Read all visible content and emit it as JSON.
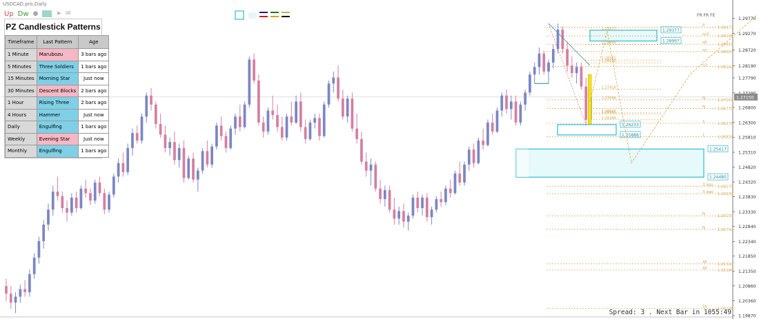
{
  "window_title": "USDCAD.pro,Daily",
  "toolbar": {
    "up": "Up",
    "dw": "Dw",
    "icons": [
      "drop-icon",
      "hand-icon",
      "plane-icon",
      "envelope-icon"
    ]
  },
  "panel": {
    "title": "PZ Candlestick Patterns",
    "headers": [
      "Timeframe",
      "Last Pattern",
      "Age"
    ],
    "rows": [
      {
        "timeframe": "1 Minute",
        "pattern": "Marubozu",
        "age": "3 bars ago",
        "kind": "bear"
      },
      {
        "timeframe": "5 Minutes",
        "pattern": "Three Soldiers",
        "age": "1 bars ago",
        "kind": "bull"
      },
      {
        "timeframe": "15 Minutes",
        "pattern": "Morning Star",
        "age": "Just now",
        "kind": "bull"
      },
      {
        "timeframe": "30 Minutes",
        "pattern": "Descent Blocks",
        "age": "2 bars ago",
        "kind": "bear"
      },
      {
        "timeframe": "1 Hour",
        "pattern": "Rising Three",
        "age": "2 bars ago",
        "kind": "bull"
      },
      {
        "timeframe": "4 Hours",
        "pattern": "Hammer",
        "age": "Just now",
        "kind": "bull"
      },
      {
        "timeframe": "Daily",
        "pattern": "Engulfing",
        "age": "1 bars ago",
        "kind": "bull"
      },
      {
        "timeframe": "Weekly",
        "pattern": "Evening Star",
        "age": "Just now",
        "kind": "bear"
      },
      {
        "timeframe": "Monthly",
        "pattern": "Engulfing",
        "age": "1 bars ago",
        "kind": "bull"
      }
    ]
  },
  "colors": {
    "bull": "#7b86c4",
    "bear": "#d47fa0",
    "zone": "#3bbfd6",
    "level": "#d4a44a",
    "trend": "#4a9bb0"
  },
  "status": "Spread: 3 . Next Bar in 1055:49",
  "chart_data": {
    "type": "candlestick",
    "symbol": "USDCAD",
    "timeframe": "Daily",
    "ylim": [
      1.1987,
      1.2997
    ],
    "current_price": "1.27150",
    "y_ticks": [
      "1.29770",
      "1.29270",
      "1.28720",
      "1.28190",
      "1.27790",
      "1.27290",
      "1.26800",
      "1.26300",
      "1.25810",
      "1.25310",
      "1.24820",
      "1.24320",
      "1.23830",
      "1.23330",
      "1.22840",
      "1.22340",
      "1.21850",
      "1.21350",
      "1.20860",
      "1.20360",
      "1.19870"
    ],
    "candles": [
      [
        1.2085,
        1.211,
        1.2035,
        1.206
      ],
      [
        1.206,
        1.2085,
        1.201,
        1.203
      ],
      [
        1.203,
        1.2065,
        1.1995,
        1.205
      ],
      [
        1.205,
        1.209,
        1.203,
        1.2075
      ],
      [
        1.2075,
        1.2105,
        1.205,
        1.2065
      ],
      [
        1.2065,
        1.214,
        1.205,
        1.2125
      ],
      [
        1.2125,
        1.2195,
        1.211,
        1.218
      ],
      [
        1.218,
        1.225,
        1.216,
        1.2235
      ],
      [
        1.2235,
        1.2305,
        1.221,
        1.229
      ],
      [
        1.229,
        1.236,
        1.227,
        1.234
      ],
      [
        1.234,
        1.242,
        1.232,
        1.24
      ],
      [
        1.24,
        1.245,
        1.237,
        1.2385
      ],
      [
        1.2385,
        1.24,
        1.233,
        1.2345
      ],
      [
        1.2345,
        1.237,
        1.23,
        1.233
      ],
      [
        1.233,
        1.2395,
        1.232,
        1.238
      ],
      [
        1.238,
        1.24,
        1.233,
        1.2345
      ],
      [
        1.2345,
        1.242,
        1.234,
        1.241
      ],
      [
        1.241,
        1.244,
        1.238,
        1.2395
      ],
      [
        1.2395,
        1.241,
        1.2355,
        1.237
      ],
      [
        1.237,
        1.244,
        1.236,
        1.243
      ],
      [
        1.243,
        1.245,
        1.2385,
        1.2395
      ],
      [
        1.2395,
        1.241,
        1.2325,
        1.234
      ],
      [
        1.234,
        1.24,
        1.233,
        1.239
      ],
      [
        1.239,
        1.246,
        1.238,
        1.245
      ],
      [
        1.245,
        1.251,
        1.243,
        1.2495
      ],
      [
        1.2495,
        1.253,
        1.245,
        1.2465
      ],
      [
        1.2465,
        1.256,
        1.2455,
        1.2545
      ],
      [
        1.2545,
        1.261,
        1.252,
        1.2595
      ],
      [
        1.2595,
        1.262,
        1.256,
        1.257
      ],
      [
        1.257,
        1.266,
        1.256,
        1.265
      ],
      [
        1.265,
        1.273,
        1.263,
        1.272
      ],
      [
        1.272,
        1.2745,
        1.267,
        1.269
      ],
      [
        1.269,
        1.27,
        1.261,
        1.2625
      ],
      [
        1.2625,
        1.266,
        1.258,
        1.259
      ],
      [
        1.259,
        1.262,
        1.253,
        1.2545
      ],
      [
        1.2545,
        1.258,
        1.252,
        1.2565
      ],
      [
        1.2565,
        1.26,
        1.249,
        1.2505
      ],
      [
        1.2505,
        1.256,
        1.248,
        1.2545
      ],
      [
        1.2545,
        1.257,
        1.243,
        1.2445
      ],
      [
        1.2445,
        1.252,
        1.244,
        1.251
      ],
      [
        1.251,
        1.253,
        1.243,
        1.244
      ],
      [
        1.244,
        1.248,
        1.24,
        1.247
      ],
      [
        1.247,
        1.2545,
        1.246,
        1.2535
      ],
      [
        1.2535,
        1.257,
        1.248,
        1.249
      ],
      [
        1.249,
        1.256,
        1.248,
        1.255
      ],
      [
        1.255,
        1.263,
        1.254,
        1.262
      ],
      [
        1.262,
        1.265,
        1.257,
        1.2585
      ],
      [
        1.2585,
        1.26,
        1.253,
        1.2545
      ],
      [
        1.2545,
        1.262,
        1.254,
        1.261
      ],
      [
        1.261,
        1.266,
        1.259,
        1.265
      ],
      [
        1.265,
        1.269,
        1.26,
        1.2615
      ],
      [
        1.2615,
        1.27,
        1.261,
        1.269
      ],
      [
        1.269,
        1.285,
        1.268,
        1.284
      ],
      [
        1.284,
        1.286,
        1.276,
        1.277
      ],
      [
        1.277,
        1.279,
        1.262,
        1.263
      ],
      [
        1.263,
        1.265,
        1.258,
        1.26
      ],
      [
        1.26,
        1.268,
        1.259,
        1.267
      ],
      [
        1.267,
        1.272,
        1.264,
        1.2655
      ],
      [
        1.2655,
        1.269,
        1.26,
        1.2615
      ],
      [
        1.2615,
        1.265,
        1.257,
        1.258
      ],
      [
        1.258,
        1.266,
        1.257,
        1.265
      ],
      [
        1.265,
        1.27,
        1.262,
        1.263
      ],
      [
        1.263,
        1.272,
        1.2625,
        1.27
      ],
      [
        1.27,
        1.273,
        1.26,
        1.2615
      ],
      [
        1.2615,
        1.264,
        1.256,
        1.2575
      ],
      [
        1.2575,
        1.264,
        1.257,
        1.263
      ],
      [
        1.263,
        1.266,
        1.261,
        1.2645
      ],
      [
        1.2645,
        1.266,
        1.257,
        1.2585
      ],
      [
        1.2585,
        1.27,
        1.258,
        1.269
      ],
      [
        1.269,
        1.277,
        1.268,
        1.276
      ],
      [
        1.276,
        1.28,
        1.273,
        1.278
      ],
      [
        1.278,
        1.282,
        1.27,
        1.271
      ],
      [
        1.271,
        1.274,
        1.264,
        1.265
      ],
      [
        1.265,
        1.272,
        1.263,
        1.271
      ],
      [
        1.271,
        1.273,
        1.26,
        1.261
      ],
      [
        1.261,
        1.266,
        1.256,
        1.2575
      ],
      [
        1.2575,
        1.26,
        1.249,
        1.25
      ],
      [
        1.25,
        1.253,
        1.245,
        1.247
      ],
      [
        1.247,
        1.251,
        1.242,
        1.249
      ],
      [
        1.249,
        1.25,
        1.24,
        1.241
      ],
      [
        1.241,
        1.244,
        1.236,
        1.2375
      ],
      [
        1.2375,
        1.242,
        1.235,
        1.2405
      ],
      [
        1.2405,
        1.242,
        1.233,
        1.234
      ],
      [
        1.234,
        1.238,
        1.229,
        1.231
      ],
      [
        1.231,
        1.235,
        1.229,
        1.2335
      ],
      [
        1.2335,
        1.236,
        1.228,
        1.23
      ],
      [
        1.23,
        1.233,
        1.227,
        1.232
      ],
      [
        1.232,
        1.239,
        1.231,
        1.238
      ],
      [
        1.238,
        1.24,
        1.233,
        1.2345
      ],
      [
        1.2345,
        1.239,
        1.232,
        1.238
      ],
      [
        1.238,
        1.2395,
        1.23,
        1.2315
      ],
      [
        1.2315,
        1.235,
        1.229,
        1.234
      ],
      [
        1.234,
        1.2385,
        1.233,
        1.2375
      ],
      [
        1.2375,
        1.24,
        1.235,
        1.2365
      ],
      [
        1.2365,
        1.242,
        1.2355,
        1.241
      ],
      [
        1.241,
        1.244,
        1.238,
        1.2395
      ],
      [
        1.2395,
        1.247,
        1.239,
        1.246
      ],
      [
        1.246,
        1.25,
        1.242,
        1.243
      ],
      [
        1.243,
        1.25,
        1.242,
        1.249
      ],
      [
        1.249,
        1.255,
        1.247,
        1.254
      ],
      [
        1.254,
        1.256,
        1.248,
        1.2495
      ],
      [
        1.2495,
        1.258,
        1.249,
        1.257
      ],
      [
        1.257,
        1.261,
        1.254,
        1.2555
      ],
      [
        1.2555,
        1.264,
        1.255,
        1.263
      ],
      [
        1.263,
        1.266,
        1.259,
        1.26
      ],
      [
        1.26,
        1.268,
        1.2595,
        1.267
      ],
      [
        1.267,
        1.273,
        1.265,
        1.272
      ],
      [
        1.272,
        1.274,
        1.266,
        1.2675
      ],
      [
        1.2675,
        1.272,
        1.264,
        1.27
      ],
      [
        1.27,
        1.272,
        1.262,
        1.263
      ],
      [
        1.263,
        1.27,
        1.262,
        1.269
      ],
      [
        1.269,
        1.274,
        1.267,
        1.273
      ],
      [
        1.273,
        1.28,
        1.272,
        1.279
      ],
      [
        1.279,
        1.283,
        1.276,
        1.2815
      ],
      [
        1.2815,
        1.288,
        1.279,
        1.286
      ],
      [
        1.286,
        1.287,
        1.279,
        1.28
      ],
      [
        1.28,
        1.284,
        1.276,
        1.283
      ],
      [
        1.283,
        1.289,
        1.281,
        1.2875
      ],
      [
        1.2875,
        1.296,
        1.286,
        1.294
      ],
      [
        1.294,
        1.295,
        1.286,
        1.2875
      ],
      [
        1.2875,
        1.29,
        1.28,
        1.282
      ],
      [
        1.282,
        1.285,
        1.278,
        1.2795
      ],
      [
        1.2795,
        1.283,
        1.276,
        1.2815
      ],
      [
        1.2815,
        1.283,
        1.274,
        1.275
      ],
      [
        1.275,
        1.278,
        1.262,
        1.264
      ],
      [
        1.264,
        1.274,
        1.263,
        1.2715
      ]
    ],
    "fib_levels": [
      {
        "value": 1.29477,
        "label": "1.29477",
        "tag": "P"
      },
      {
        "value": 1.29186,
        "label": "1.29186",
        "tag": "sx2"
      },
      {
        "value": 1.2891,
        "label": "1.28910",
        "tag": "s8"
      },
      {
        "value": 1.28665,
        "label": "1.28665",
        "tag": "sx"
      },
      {
        "value": 1.28162,
        "label": "1.28162",
        "tag": "u1"
      },
      {
        "value": 1.27058,
        "label": "1.27058",
        "tag": "N"
      },
      {
        "value": 1.2677,
        "label": "1.26770",
        "tag": "N"
      },
      {
        "value": 1.26276,
        "label": "1.26276",
        "tag": "1"
      },
      {
        "value": 1.25826,
        "label": "1.25826",
        "tag": "1"
      },
      {
        "value": 1.24179,
        "label": "1.24179",
        "tag": "3 app"
      },
      {
        "value": 1.2393,
        "label": "1.23930",
        "tag": "3 app"
      },
      {
        "value": 1.23193,
        "label": "1.23193",
        "tag": "N"
      },
      {
        "value": 1.22742,
        "label": "1.22742",
        "tag": "N"
      },
      {
        "value": 1.21594,
        "label": "1.21594",
        "tag": "4P"
      },
      {
        "value": 1.21386,
        "label": "1.21386",
        "tag": "4P"
      },
      {
        "value": 1.20106,
        "label": "1.20106",
        "tag": "5b"
      }
    ],
    "fib_header": "FR FR FE",
    "zones": [
      {
        "top": 1.29377,
        "bottom": 1.29017,
        "label_top": "1.29377",
        "label_bottom": "1.28997"
      },
      {
        "top": 1.26233,
        "bottom": 1.25888,
        "label_top": "1.26233",
        "label_bottom": "1.25888"
      },
      {
        "top": 1.25417,
        "bottom": 1.2448,
        "label_top": "1.25417",
        "label_bottom": "1.24480"
      }
    ],
    "inner_labels": [
      "1.29377",
      "1.28899",
      "1.28381",
      "1.28290",
      "1.27416",
      "1.27058",
      "1.26622",
      "1.26581",
      "1.26394"
    ]
  }
}
